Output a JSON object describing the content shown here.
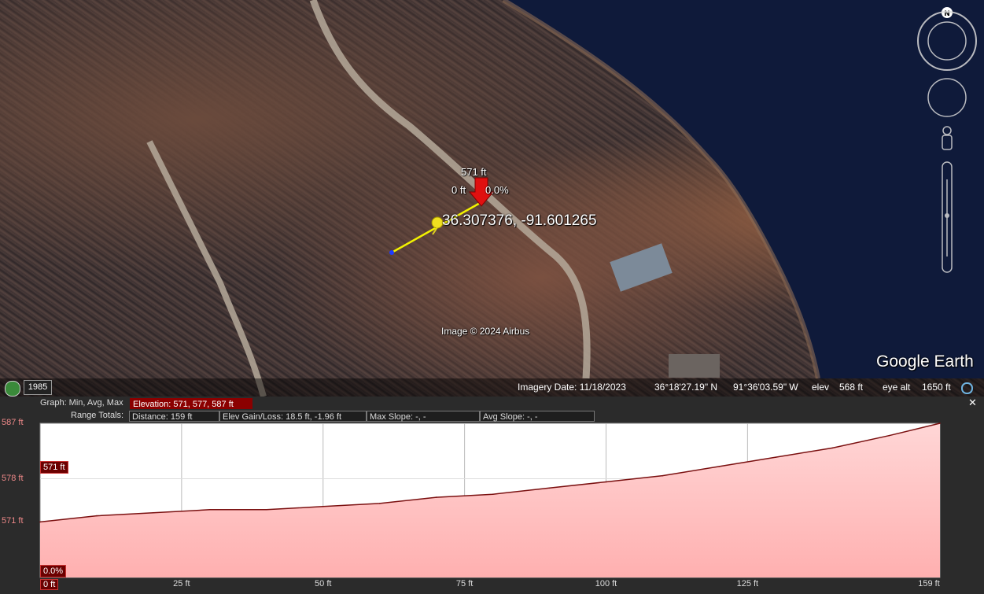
{
  "map": {
    "point_elevation": "571 ft",
    "point_distance": "0 ft",
    "point_slope": "0.0%",
    "coordinates": "36.307376, -91.601265",
    "attribution": "Image © 2024 Airbus",
    "logo": "Google Earth",
    "compass_north": "N",
    "historical_year": "1985"
  },
  "status_bar": {
    "imagery_date": "Imagery Date: 11/18/2023",
    "latitude": "36°18'27.19\" N",
    "longitude": "91°36'03.59\" W",
    "elev_label": "elev",
    "elev_value": "568 ft",
    "eye_alt_label": "eye alt",
    "eye_alt_value": "1650 ft"
  },
  "profile": {
    "graph_label": "Graph: Min, Avg, Max",
    "elevation_stats": "Elevation: 571, 577, 587 ft",
    "range_totals_label": "Range Totals:",
    "distance": "Distance: 159 ft",
    "elev_gain_loss": "Elev Gain/Loss: 18.5 ft, -1.96 ft",
    "max_slope": "Max Slope: -, -",
    "avg_slope": "Avg Slope: -, -",
    "close_label": "✕",
    "cursor_elevation_tag": "571 ft",
    "cursor_slope_tag": "0.0%",
    "cursor_distance_tag": "0 ft"
  },
  "chart_data": {
    "type": "area",
    "x": [
      0,
      10,
      20,
      30,
      40,
      50,
      60,
      70,
      80,
      90,
      100,
      110,
      120,
      130,
      140,
      150,
      159
    ],
    "y": [
      571,
      572,
      572.5,
      573,
      573,
      573.5,
      574,
      575,
      575.5,
      576.5,
      577.5,
      578.5,
      580,
      581.5,
      583,
      585,
      587
    ],
    "series": [
      {
        "name": "Elevation",
        "color": "#7a1010"
      }
    ],
    "y_ticks": [
      "587 ft",
      "578 ft",
      "571 ft"
    ],
    "y_tick_values": [
      587,
      578,
      571
    ],
    "x_ticks": [
      "0 ft",
      "25 ft",
      "50 ft",
      "75 ft",
      "100 ft",
      "125 ft",
      "159 ft"
    ],
    "x_tick_values": [
      0,
      25,
      50,
      75,
      100,
      125,
      159
    ],
    "xlim": [
      0,
      159
    ],
    "ylim": [
      562,
      587
    ],
    "grid": true,
    "fill_color_top": "#ffd6d6",
    "fill_color_bottom": "#ffb0b0"
  }
}
